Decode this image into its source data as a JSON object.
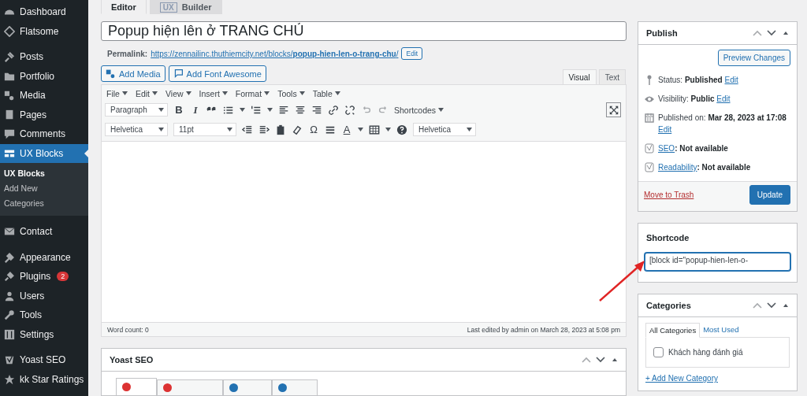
{
  "sidebar": {
    "items": [
      {
        "label": "Dashboard",
        "selected": false
      },
      {
        "label": "Flatsome",
        "selected": false
      },
      {
        "label": "Posts",
        "selected": false
      },
      {
        "label": "Portfolio",
        "selected": false
      },
      {
        "label": "Media",
        "selected": false
      },
      {
        "label": "Pages",
        "selected": false
      },
      {
        "label": "Comments",
        "selected": false
      },
      {
        "label": "UX Blocks",
        "selected": true,
        "children": [
          {
            "label": "UX Blocks",
            "selected": true
          },
          {
            "label": "Add New",
            "selected": false
          },
          {
            "label": "Categories",
            "selected": false
          }
        ]
      },
      {
        "label": "Contact",
        "selected": false
      },
      {
        "label": "Appearance",
        "selected": false
      },
      {
        "label": "Plugins",
        "selected": false,
        "badge": "2"
      },
      {
        "label": "Users",
        "selected": false
      },
      {
        "label": "Tools",
        "selected": false
      },
      {
        "label": "Settings",
        "selected": false
      },
      {
        "label": "Yoast SEO",
        "selected": false
      },
      {
        "label": "kk Star Ratings",
        "selected": false
      }
    ]
  },
  "editor_tabs": [
    {
      "label": "Editor",
      "selected": true
    },
    {
      "logo": "UX",
      "label": "Builder",
      "selected": false
    }
  ],
  "title_field": {
    "value": "Popup hiện lên ở TRANG CHỦ"
  },
  "permalink": {
    "label": "Permalink:",
    "url": "https://zennailinc.thuthiemcity.net/blocks/**popup-hien-len-o-trang-chu**/",
    "edit_button": "Edit"
  },
  "media_buttons": [
    "Add Media",
    "Add Font Awesome"
  ],
  "mode_tabs": [
    {
      "label": "Visual",
      "selected": true
    },
    {
      "label": "Text",
      "selected": false
    }
  ],
  "menubar": [
    "File",
    "Edit",
    "View",
    "Insert",
    "Format",
    "Tools",
    "Table"
  ],
  "toolbar_1": [
    {
      "kind": "select",
      "text": "Paragraph"
    },
    {
      "kind": "glyph",
      "text": "B"
    },
    {
      "kind": "glyph",
      "text": "I"
    },
    {
      "kind": "icon"
    },
    {
      "kind": "icon"
    },
    {
      "kind": "icon"
    },
    {
      "kind": "icon"
    },
    {
      "kind": "icon"
    },
    {
      "kind": "icon"
    },
    {
      "kind": "icon"
    },
    {
      "kind": "icon"
    },
    {
      "kind": "icon"
    },
    {
      "kind": "icon"
    },
    {
      "kind": "menu",
      "text": "Shortcodes"
    }
  ],
  "toolbar_2": [
    {
      "kind": "select",
      "text": "Helvetica"
    },
    {
      "kind": "select",
      "text": "11pt"
    },
    {
      "kind": "icon"
    },
    {
      "kind": "icon"
    },
    {
      "kind": "icon"
    },
    {
      "kind": "icon"
    },
    {
      "kind": "glyph",
      "text": "Ω"
    },
    {
      "kind": "icon"
    },
    {
      "kind": "glyph",
      "text": "A"
    },
    {
      "kind": "icon"
    },
    {
      "kind": "icon"
    },
    {
      "kind": "select",
      "text": "Helvetica"
    }
  ],
  "status_bar": {
    "word_count": "Word count: 0",
    "last_edited": "Last edited by admin on March 28, 2023 at 5:08 pm"
  },
  "yoast": {
    "title": "Yoast SEO",
    "tabs": [
      {
        "selected": true,
        "color": "#dc3232"
      },
      {
        "selected": false,
        "color": "#dc3232"
      },
      {
        "selected": false,
        "color": "#2271b1"
      },
      {
        "selected": false,
        "color": "#2271b1"
      }
    ]
  },
  "publish": {
    "title": "Publish",
    "preview_button": "Preview Changes",
    "rows": [
      {
        "label": "Status:",
        "value": "Published",
        "link": "Edit"
      },
      {
        "label": "Visibility:",
        "value": "Public",
        "link": "Edit"
      },
      {
        "label": "Published on:",
        "value": "Mar 28, 2023 at 17:08",
        "link": "Edit"
      },
      {
        "link": "SEO",
        "value": ": Not available"
      },
      {
        "link": "Readability",
        "value": ": Not available"
      }
    ],
    "trash_link": "Move to Trash",
    "update_button": "Update"
  },
  "shortcode": {
    "title": "Shortcode",
    "value": "[block id=\"popup-hien-len-o-"
  },
  "categories": {
    "title": "Categories",
    "tabs": [
      {
        "label": "All Categories",
        "selected": true
      },
      {
        "label": "Most Used",
        "selected": false
      }
    ],
    "items": [
      {
        "label": "Khách hàng đánh giá",
        "checked": false
      }
    ],
    "add_link": "+ Add New Category"
  }
}
